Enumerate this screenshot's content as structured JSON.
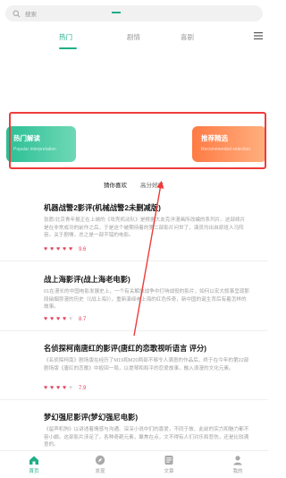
{
  "search": {
    "placeholder": "搜索"
  },
  "tabs": [
    {
      "label": "热门",
      "active": true
    },
    {
      "label": "剧情",
      "active": false
    },
    {
      "label": "喜剧",
      "active": false
    }
  ],
  "banner": {
    "left": {
      "title": "热门解读",
      "subtitle": "Popular interpretation"
    },
    "right": {
      "title": "推荐精选",
      "subtitle": "Recommended selection"
    }
  },
  "subtabs": [
    {
      "label": "猜你喜欢",
      "active": true
    },
    {
      "label": "高分好评",
      "active": false
    }
  ],
  "articles": [
    {
      "title": "机器战警2影评(机械战警2未删减版)",
      "desc": "张愿/北京青年报正在上映的《攻壳机动队》是根据大友克洋漫画所改编的系列片。这部续片是在非常成功的前作之后，于是这个被期待着的第二部影片问世了，演员均出自原班人马阵容。关于剧情，总之是一部不错的电影。",
      "rating": 9.6,
      "hearts": 5
    },
    {
      "title": "战上海影评(战上海老电影)",
      "desc": "01在漫长的中国电影发展史上，一个有关解放战争中打响战役的影片，如何以宏大叙事呈现那段硝烟弥漫的历史（《战上海》），重新演绎老上海的红色传奇，新中国的诞生背后有着怎样的故事。",
      "rating": 8.7,
      "hearts": 4
    },
    {
      "title": "名侦探柯南唐红的影评(唐红的恋歌视听语言 评分)",
      "desc": "《名侦探柯南》剧场版在经历了M19和M20两部不够令人满意的作品后，终于在今年的第22部剧场版《唐红的恋歌》中扳回一局，以提琴和和平的恋爱故事，融入浪漫的文化元素。",
      "rating": 7.9,
      "hearts": 4
    },
    {
      "title": "梦幻强尼影评(梦幻强尼电影)",
      "desc": "《留声机狗》以讲述着情感与沟通、深深小说中们的喜爱，不同于故、此前的实力和魅力都不容小觑。这部影片涉足了，各种奇葩元素，聚焦在点，文不得有人们对乐和悲伤，还是比较满意的。",
      "rating": null,
      "hearts": 0
    }
  ],
  "bottom_nav": [
    {
      "label": "首页",
      "icon": "home-icon",
      "active": true
    },
    {
      "label": "发现",
      "icon": "compass-icon",
      "active": false
    },
    {
      "label": "文章",
      "icon": "article-icon",
      "active": false
    },
    {
      "label": "我的",
      "icon": "user-icon",
      "active": false
    }
  ],
  "colors": {
    "accent": "#1fae86",
    "highlight": "#ee3b3b",
    "rating": "#e3445f"
  }
}
